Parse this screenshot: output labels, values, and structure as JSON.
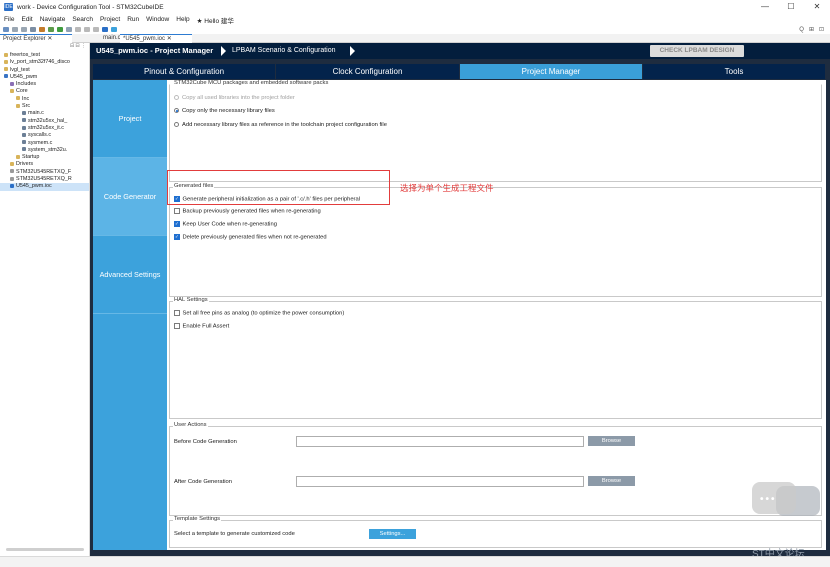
{
  "window": {
    "title": "work - Device Configuration Tool - STM32CubeIDE",
    "app_icon_label": "IDE",
    "controls": [
      "—",
      "☐",
      "✕"
    ]
  },
  "menu": [
    "File",
    "Edit",
    "Navigate",
    "Search",
    "Project",
    "Run",
    "Window",
    "Help",
    "★ Hello 建华"
  ],
  "toolbar_right": [
    "Q",
    "⊞",
    "⊡"
  ],
  "tabs": {
    "explorer": "Project Explorer ✕",
    "main_c": "main.c",
    "ioc": "*U545_pwm.ioc ✕"
  },
  "explorer": {
    "tools": "⊟ ⊟ ⋮",
    "items": [
      {
        "label": "freertos_test",
        "indent": 0,
        "icon": "folder-icon"
      },
      {
        "label": "lv_port_stm32f746_disco",
        "indent": 0,
        "icon": "folder-icon"
      },
      {
        "label": "lvgl_test",
        "indent": 0,
        "icon": "folder-icon"
      },
      {
        "label": "U545_pwm",
        "indent": 0,
        "icon": "project-icon"
      },
      {
        "label": "Includes",
        "indent": 1,
        "icon": "include-icon"
      },
      {
        "label": "Core",
        "indent": 1,
        "icon": "folder-icon"
      },
      {
        "label": "Inc",
        "indent": 2,
        "icon": "folder-icon"
      },
      {
        "label": "Src",
        "indent": 2,
        "icon": "folder-icon"
      },
      {
        "label": "main.c",
        "indent": 3,
        "icon": "c-file-icon"
      },
      {
        "label": "stm32u5xx_hal_",
        "indent": 3,
        "icon": "c-file-icon"
      },
      {
        "label": "stm32u5xx_it.c",
        "indent": 3,
        "icon": "c-file-icon"
      },
      {
        "label": "syscalls.c",
        "indent": 3,
        "icon": "c-file-icon"
      },
      {
        "label": "sysmem.c",
        "indent": 3,
        "icon": "c-file-icon"
      },
      {
        "label": "system_stm32u.",
        "indent": 3,
        "icon": "c-file-icon"
      },
      {
        "label": "Startup",
        "indent": 2,
        "icon": "folder-icon"
      },
      {
        "label": "Drivers",
        "indent": 1,
        "icon": "folder-icon"
      },
      {
        "label": "STM32U545RETXQ_F",
        "indent": 1,
        "icon": "file-icon"
      },
      {
        "label": "STM32U545RETXQ_R",
        "indent": 1,
        "icon": "file-icon"
      },
      {
        "label": "U545_pwm.ioc",
        "indent": 1,
        "icon": "ioc-file-icon",
        "selected": true
      }
    ]
  },
  "breadcrumb": {
    "file": "U545_pwm.ioc - Project Manager",
    "scenario": "LPBAM Scenario & Configuration",
    "check_button": "CHECK LPBAM DESIGN"
  },
  "main_tabs": [
    {
      "label": "Pinout & Configuration",
      "active": false
    },
    {
      "label": "Clock Configuration",
      "active": false
    },
    {
      "label": "Project Manager",
      "active": true
    },
    {
      "label": "Tools",
      "active": false
    }
  ],
  "side_nav": [
    {
      "label": "Project",
      "active": false
    },
    {
      "label": "Code Generator",
      "active": true
    },
    {
      "label": "Advanced Settings",
      "active": false
    }
  ],
  "packages_group": {
    "title": "STM32Cube MCU packages and embedded software packs",
    "options": [
      {
        "label": "Copy all used libraries into the project folder",
        "selected": false,
        "disabled": true
      },
      {
        "label": "Copy only the necessary library files",
        "selected": true,
        "disabled": false
      },
      {
        "label": "Add necessary library files as reference in the toolchain project configuration file",
        "selected": false,
        "disabled": false
      }
    ]
  },
  "generated_files_group": {
    "title": "Generated files",
    "options": [
      {
        "label": "Generate peripheral initialization as a pair of '.c/.h' files per peripheral",
        "checked": true
      },
      {
        "label": "Backup previously generated files when re-generating",
        "checked": false
      },
      {
        "label": "Keep User Code when re-generating",
        "checked": true
      },
      {
        "label": "Delete previously generated files when not re-generated",
        "checked": true
      }
    ]
  },
  "annotation": "选择为单个生成工程文件",
  "hal_group": {
    "title": "HAL Settings",
    "options": [
      {
        "label": "Set all free pins as analog (to optimize the power consumption)",
        "checked": false
      },
      {
        "label": "Enable Full Assert",
        "checked": false
      }
    ]
  },
  "user_actions_group": {
    "title": "User Actions",
    "before_label": "Before Code Generation",
    "after_label": "After Code Generation",
    "before_value": "",
    "after_value": "",
    "browse": "Browse"
  },
  "template_group": {
    "title": "Template Settings",
    "label": "Select a template to generate customized code",
    "button": "Settings..."
  },
  "watermark": {
    "dots": "•••",
    "text": "ST中文论坛"
  },
  "colors": {
    "nav_dark": "#03234b",
    "accent_blue": "#3ca2dc",
    "annotation_red": "#e23c3c"
  }
}
